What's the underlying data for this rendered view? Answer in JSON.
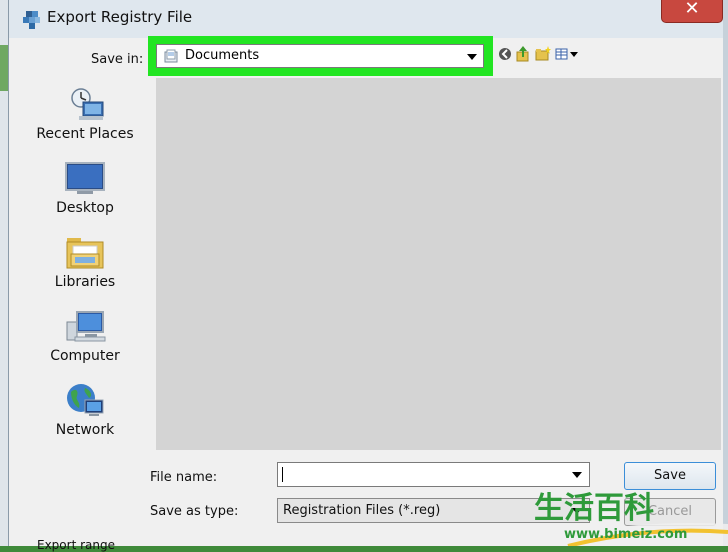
{
  "dialog": {
    "title": "Export Registry File",
    "close_symbol": "✕"
  },
  "save_in": {
    "label": "Save in:",
    "value": "Documents"
  },
  "toolbar": {
    "icons": [
      "back-icon",
      "up-folder-icon",
      "new-folder-icon",
      "view-menu-icon"
    ]
  },
  "places": [
    {
      "label": "Recent Places",
      "icon": "recent-places-icon"
    },
    {
      "label": "Desktop",
      "icon": "desktop-icon"
    },
    {
      "label": "Libraries",
      "icon": "libraries-icon"
    },
    {
      "label": "Computer",
      "icon": "computer-icon"
    },
    {
      "label": "Network",
      "icon": "network-icon"
    }
  ],
  "file_name": {
    "label": "File name:",
    "value": ""
  },
  "save_as_type": {
    "label": "Save as type:",
    "value": "Registration Files (*.reg)"
  },
  "buttons": {
    "save": "Save",
    "cancel": "Cancel"
  },
  "export_range": {
    "label": "Export range"
  },
  "watermark": {
    "chars": "生活百科",
    "url": "www.bimeiz.com"
  },
  "colors": {
    "highlight": "#22e522",
    "background_green": "#3f8a3a",
    "close_red": "#c8483f"
  }
}
